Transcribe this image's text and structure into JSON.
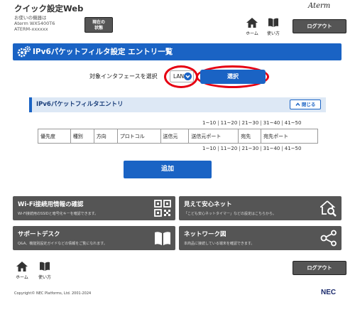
{
  "header": {
    "app_title": "クイック設定Web",
    "device_label": "お使いの機器は",
    "model": "Aterm WX5400T6",
    "device_id": "ATERM-xxxxxx",
    "status_button": "現在の\n状態",
    "brand": "Aterm",
    "home_label": "ホーム",
    "howto_label": "使い方",
    "logout_label": "ログアウト"
  },
  "page": {
    "title": "IPv6パケットフィルタ設定 エントリ一覧",
    "interface_label": "対象インタフェースを選択",
    "interface_value": "LAN",
    "select_button": "選択",
    "entry_section_title": "IPv6パケットフィルタエントリ",
    "close_button": "閉じる",
    "pages": [
      "1~10",
      "11~20",
      "21~30",
      "31~40",
      "41~50"
    ],
    "columns": [
      "優先度",
      "種別",
      "方向",
      "プロトコル",
      "送信元",
      "送信元ポート",
      "宛先",
      "宛先ポート"
    ],
    "add_button": "追加"
  },
  "cards": [
    {
      "title": "Wi-Fi接続用情報の確認",
      "desc": "Wi-Fi接続用のSSIDと暗号化キーを確認できます。",
      "icon": "qr-code-icon"
    },
    {
      "title": "見えて安心ネット",
      "desc": "「こども安心ネットタイマー」などの設定はこちらから。",
      "icon": "home-search-icon"
    },
    {
      "title": "サポートデスク",
      "desc": "Q&A、機能別設定ガイドなどの情報をご覧になれます。",
      "icon": "book-icon"
    },
    {
      "title": "ネットワーク図",
      "desc": "本商品に接続している端末を確認できます。",
      "icon": "network-icon"
    }
  ],
  "footer": {
    "home_label": "ホーム",
    "howto_label": "使い方",
    "logout_label": "ログアウト",
    "copyright": "Copyright© NEC Platforms, Ltd. 2001-2024",
    "company": "NEC"
  },
  "colors": {
    "accent": "#1a63c4",
    "highlight_ring": "#e60012",
    "dark_button": "#555555"
  }
}
